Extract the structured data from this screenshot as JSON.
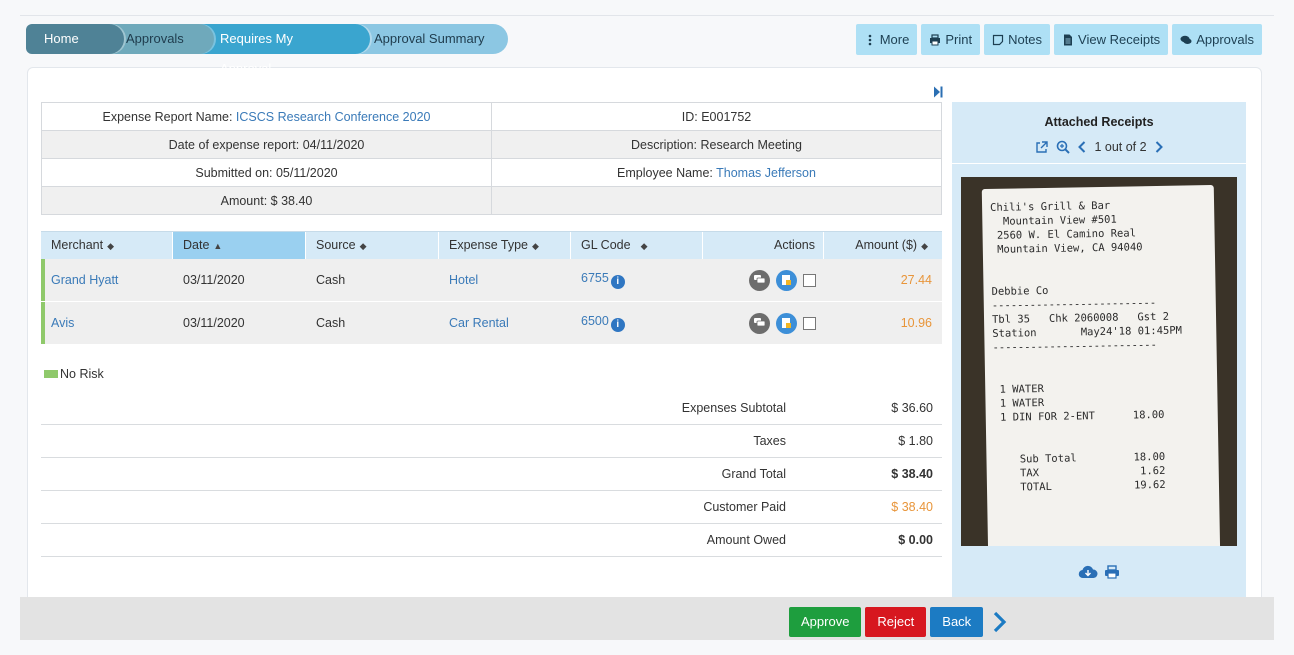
{
  "breadcrumb": [
    "Home",
    "Approvals",
    "Requires My Approval",
    "Approval Summary"
  ],
  "toolbar": {
    "more": "More",
    "print": "Print",
    "notes": "Notes",
    "view_receipts": "View Receipts",
    "approvals": "Approvals"
  },
  "info": {
    "report_name_label": "Expense Report Name:",
    "report_name": "ICSCS Research Conference 2020",
    "id_label": "ID:",
    "id": "E001752",
    "date_label": "Date of expense report:",
    "date": "04/11/2020",
    "description_label": "Description:",
    "description": "Research Meeting",
    "submitted_label": "Submitted on:",
    "submitted": "05/11/2020",
    "employee_label": "Employee Name:",
    "employee": "Thomas Jefferson",
    "amount_label": "Amount:",
    "amount": "$ 38.40"
  },
  "grid": {
    "headers": {
      "merchant": "Merchant",
      "date": "Date",
      "source": "Source",
      "expense_type": "Expense Type",
      "gl_code": "GL Code",
      "actions": "Actions",
      "amount": "Amount ($)"
    },
    "rows": [
      {
        "merchant": "Grand Hyatt",
        "date": "03/11/2020",
        "source": "Cash",
        "expense_type": "Hotel",
        "gl_code": "6755",
        "amount": "27.44"
      },
      {
        "merchant": "Avis",
        "date": "03/11/2020",
        "source": "Cash",
        "expense_type": "Car Rental",
        "gl_code": "6500",
        "amount": "10.96"
      }
    ]
  },
  "legend": "No Risk",
  "totals": {
    "subtotal_label": "Expenses Subtotal",
    "subtotal": "$ 36.60",
    "taxes_label": "Taxes",
    "taxes": "$ 1.80",
    "grand_label": "Grand Total",
    "grand": "$ 38.40",
    "paid_label": "Customer Paid",
    "paid": "$ 38.40",
    "owed_label": "Amount Owed",
    "owed": "$ 0.00"
  },
  "receipts": {
    "title": "Attached Receipts",
    "pager": "1 out of 2",
    "receipt_text": "Chili's Grill & Bar\n  Mountain View #501\n 2560 W. El Camino Real\n Mountain View, CA 94040\n\n\nDebbie Co\n--------------------------\nTbl 35   Chk 2060008   Gst 2\nStation       May24'18 01:45PM\n--------------------------\n\n\n 1 WATER\n 1 WATER\n 1 DIN FOR 2-ENT      18.00\n\n\n    Sub Total         18.00\n    TAX                1.62\n    TOTAL             19.62"
  },
  "footer": {
    "approve": "Approve",
    "reject": "Reject",
    "back": "Back"
  },
  "colors": {
    "accent": "#3a7ab8",
    "risk_none": "#8fc96b",
    "approve": "#1e9e3e",
    "reject": "#d7171f",
    "back": "#1c7bc3"
  }
}
